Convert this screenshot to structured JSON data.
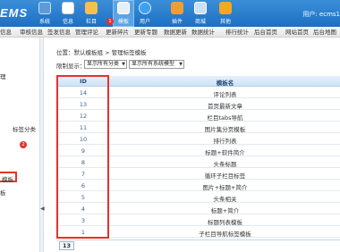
{
  "app": {
    "logo": "EMS"
  },
  "topnav": [
    {
      "label": "系统",
      "icon": "system-icon",
      "color": "#5e9bd6"
    },
    {
      "label": "信息",
      "icon": "info-icon",
      "color": "#ffffff"
    },
    {
      "label": "栏目",
      "icon": "column-icon",
      "color": "#f2c14e"
    },
    {
      "label": "模板",
      "icon": "template-icon",
      "color": "#e8eef5"
    },
    {
      "label": "用户",
      "icon": "user-icon",
      "color": "#3da0f2"
    },
    {
      "label": "插件",
      "icon": "plugin-icon",
      "color": "#f29c38"
    },
    {
      "label": "商城",
      "icon": "shop-icon",
      "color": "#c9e0f5"
    },
    {
      "label": "其他",
      "icon": "other-icon",
      "color": "#f5a623"
    }
  ],
  "badges": {
    "topnav": "1",
    "sidebar": "2"
  },
  "user": {
    "text": "用户: ecms1"
  },
  "subnav": [
    "信息",
    "审核信息",
    "签发信息",
    "管理评论",
    "更新碎片",
    "更新专题",
    "数据更新",
    "数据统计",
    "排行统计",
    "后台首页",
    "网站首页",
    "后台地图"
  ],
  "sidebar": {
    "item_top": "理",
    "item_mid": "标签分类",
    "item_hl": "模板",
    "item_bottom": "板"
  },
  "breadcrumb": "位置：默认模板组 > 管理标签模板",
  "filter": {
    "label": "限制显示：",
    "category": "显示所有分类",
    "model": "显示所有系统模型"
  },
  "table": {
    "headers": {
      "id": "ID",
      "name": "模板名"
    },
    "rows": [
      {
        "id": "14",
        "name": "评论列表"
      },
      {
        "id": "13",
        "name": "首页最新文章"
      },
      {
        "id": "12",
        "name": "栏目tabs导航"
      },
      {
        "id": "11",
        "name": "图片集分页模板"
      },
      {
        "id": "10",
        "name": "排行列表"
      },
      {
        "id": "9",
        "name": "标题+软件简介"
      },
      {
        "id": "8",
        "name": "头条标题"
      },
      {
        "id": "7",
        "name": "循环子栏目标签"
      },
      {
        "id": "6",
        "name": "图片+标题+简介"
      },
      {
        "id": "5",
        "name": "头条相关"
      },
      {
        "id": "4",
        "name": "标题+简介"
      },
      {
        "id": "3",
        "name": "标题列表模板"
      },
      {
        "id": "1",
        "name": "子栏目导航标签模板"
      }
    ],
    "count": "13"
  }
}
